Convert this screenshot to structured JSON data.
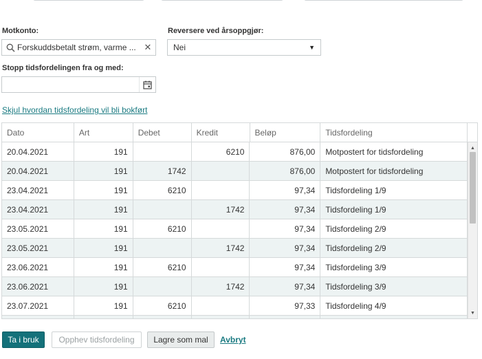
{
  "form": {
    "motkonto_label": "Motkonto:",
    "motkonto_value": "Forskuddsbetalt strøm, varme ...",
    "reversere_label": "Reversere ved årsoppgjør:",
    "reversere_value": "Nei",
    "stopp_label": "Stopp tidsfordelingen fra og med:",
    "stopp_value": ""
  },
  "toggle_link": "Skjul hvordan tidsfordeling vil bli bokført",
  "grid": {
    "columns": [
      "Dato",
      "Art",
      "Debet",
      "Kredit",
      "Beløp",
      "Tidsfordeling"
    ],
    "rows": [
      [
        "20.04.2021",
        "191",
        "",
        "6210",
        "876,00",
        "Motpostert for tidsfordeling"
      ],
      [
        "20.04.2021",
        "191",
        "1742",
        "",
        "876,00",
        "Motpostert for tidsfordeling"
      ],
      [
        "23.04.2021",
        "191",
        "6210",
        "",
        "97,34",
        "Tidsfordeling 1/9"
      ],
      [
        "23.04.2021",
        "191",
        "",
        "1742",
        "97,34",
        "Tidsfordeling 1/9"
      ],
      [
        "23.05.2021",
        "191",
        "6210",
        "",
        "97,34",
        "Tidsfordeling 2/9"
      ],
      [
        "23.05.2021",
        "191",
        "",
        "1742",
        "97,34",
        "Tidsfordeling 2/9"
      ],
      [
        "23.06.2021",
        "191",
        "6210",
        "",
        "97,34",
        "Tidsfordeling 3/9"
      ],
      [
        "23.06.2021",
        "191",
        "",
        "1742",
        "97,34",
        "Tidsfordeling 3/9"
      ],
      [
        "23.07.2021",
        "191",
        "6210",
        "",
        "97,33",
        "Tidsfordeling 4/9"
      ],
      [
        "",
        "",
        "",
        "",
        "",
        ""
      ]
    ]
  },
  "buttons": {
    "apply": "Ta i bruk",
    "revoke": "Opphev tidsfordeling",
    "save_template": "Lagre som mal",
    "cancel": "Avbryt"
  },
  "icons": {
    "search": "search-icon",
    "clear": "close-icon",
    "dropdown": "chevron-down-icon",
    "calendar": "calendar-icon"
  },
  "colors": {
    "accent": "#14717a",
    "link": "#1b7b82",
    "row_alt": "#edf3f3"
  }
}
